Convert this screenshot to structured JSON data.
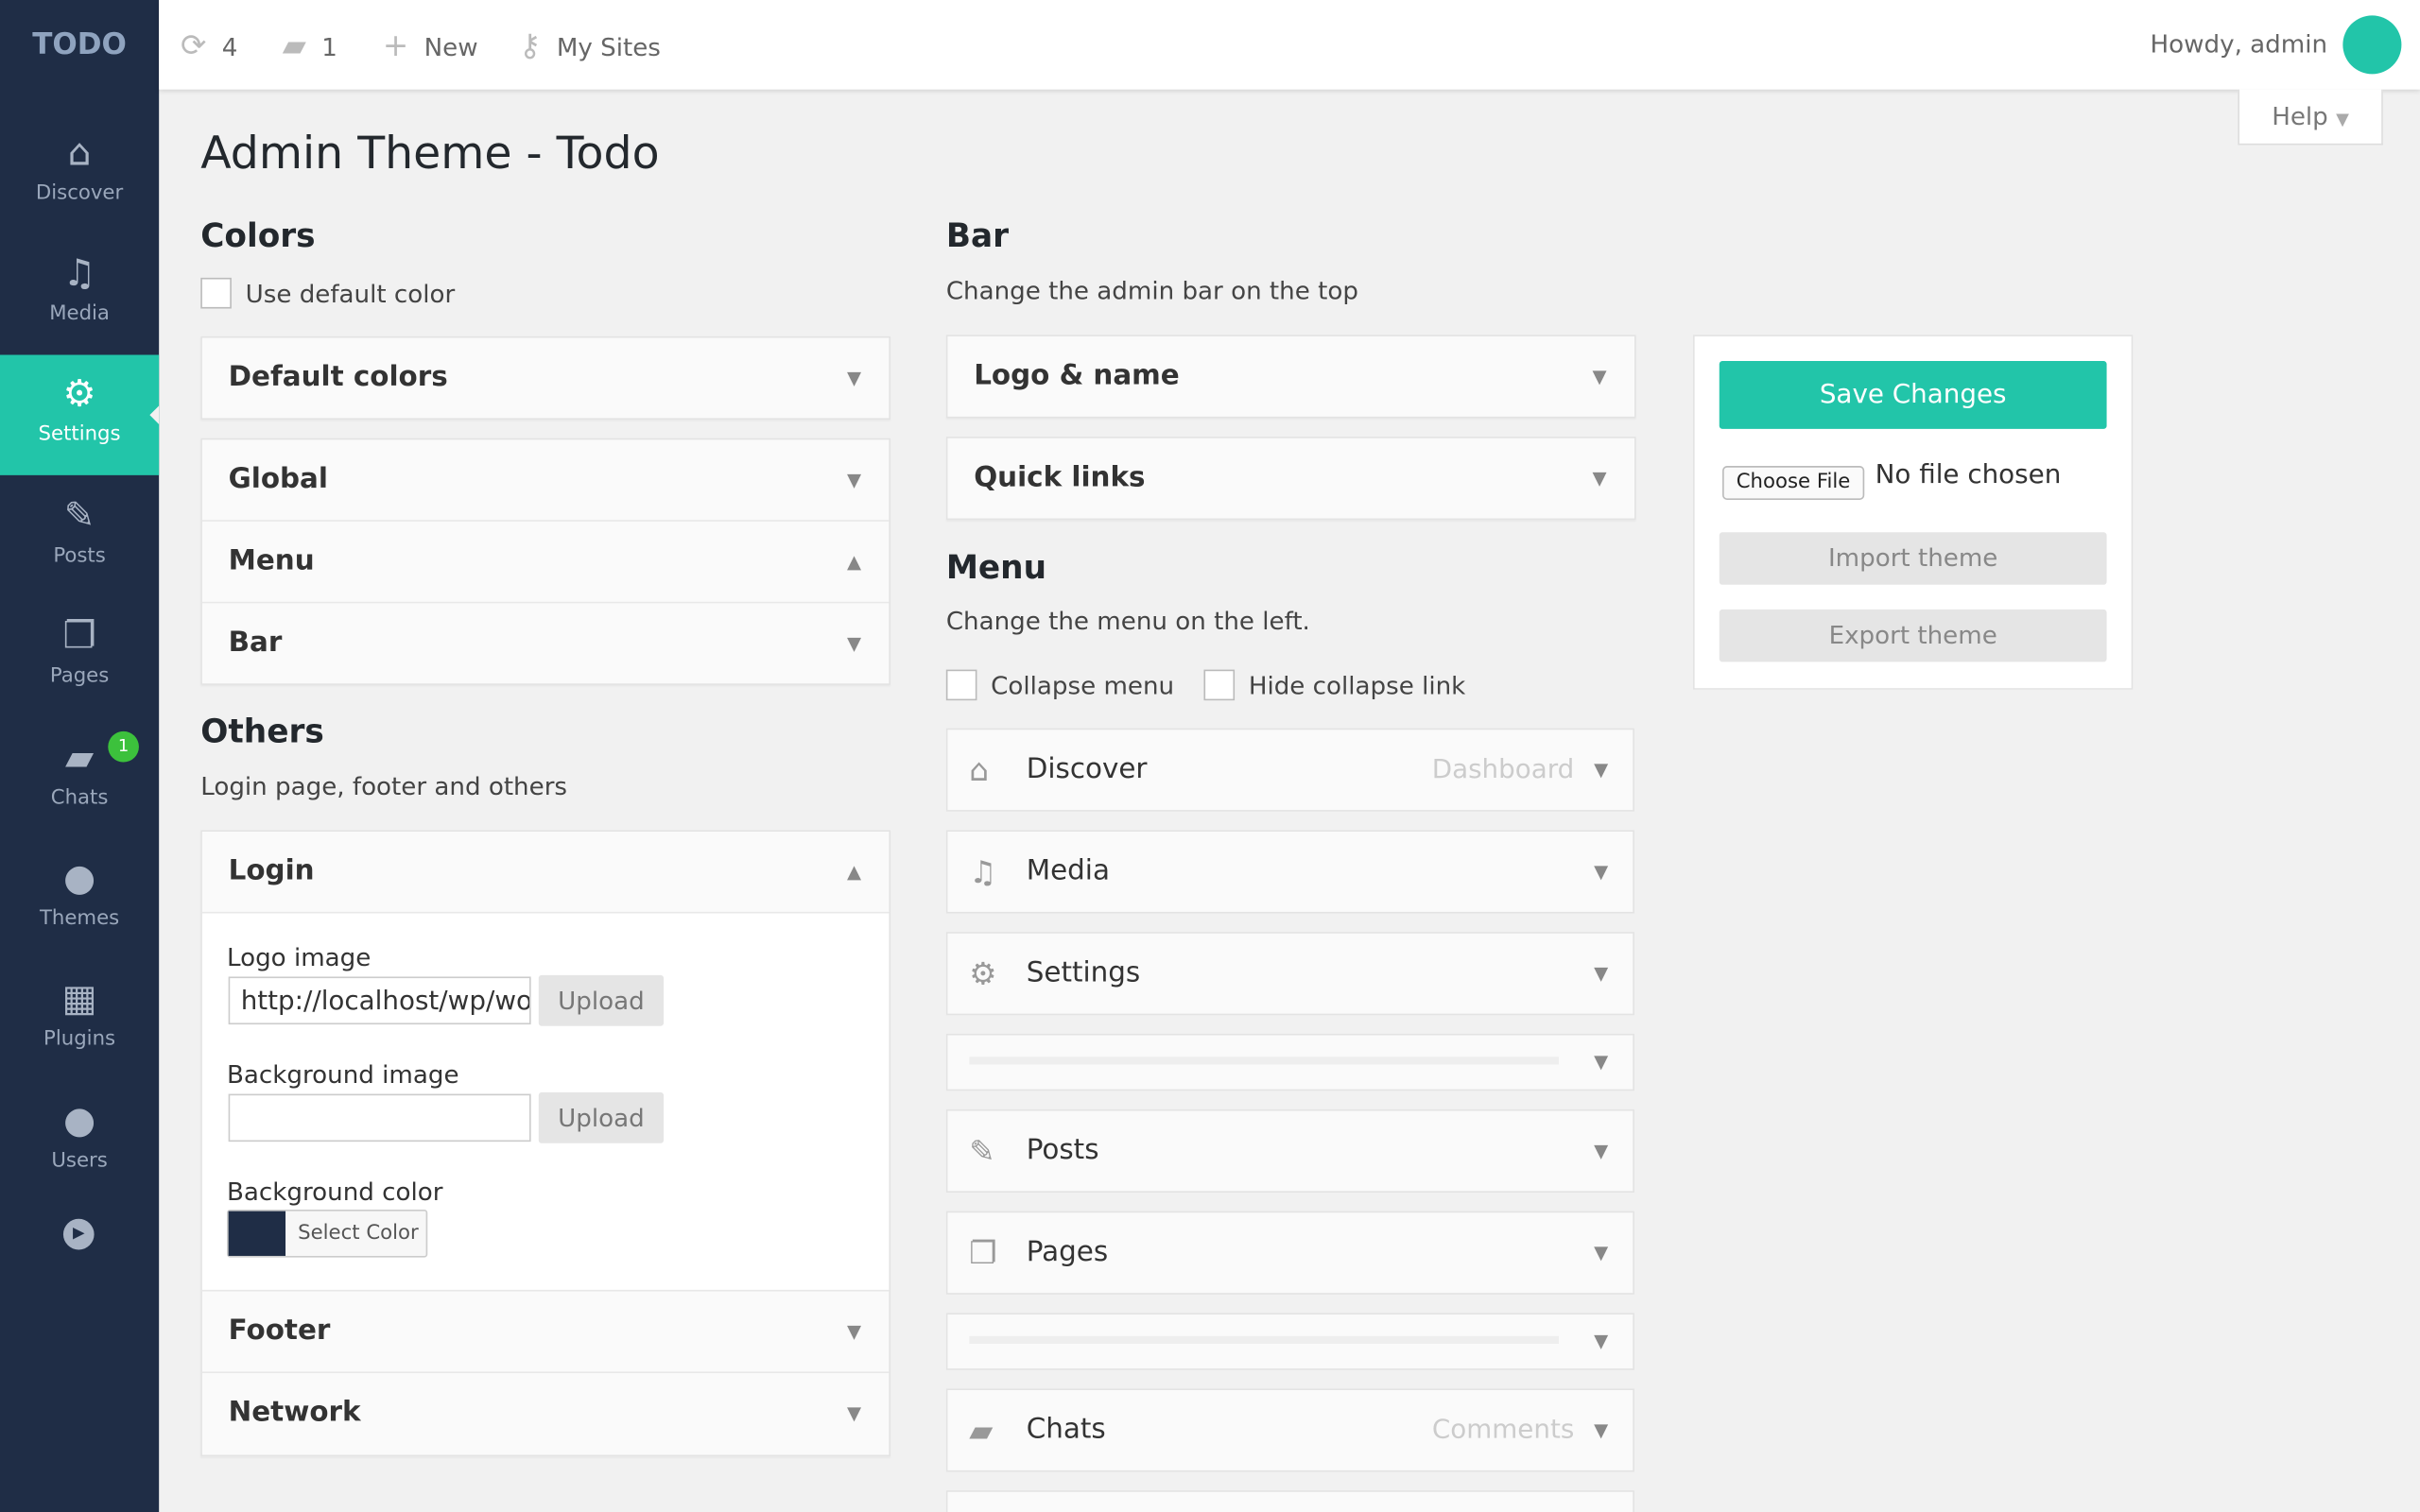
{
  "app": {
    "logo": "TODO",
    "title": "Admin Theme - Todo"
  },
  "topbar": {
    "updates": "4",
    "comments": "1",
    "new": "New",
    "my_sites": "My Sites",
    "howdy": "Howdy, admin",
    "help": "Help"
  },
  "sidebar": {
    "items": [
      {
        "label": "Discover",
        "icon": "home-icon"
      },
      {
        "label": "Media",
        "icon": "media-icon"
      },
      {
        "label": "Settings",
        "icon": "gear-icon",
        "active": true
      },
      {
        "label": "Posts",
        "icon": "pin-icon"
      },
      {
        "label": "Pages",
        "icon": "pages-icon"
      },
      {
        "label": "Chats",
        "icon": "chat-icon",
        "badge": "1"
      },
      {
        "label": "Themes",
        "icon": "drop-icon"
      },
      {
        "label": "Plugins",
        "icon": "grid-icon"
      },
      {
        "label": "Users",
        "icon": "user-icon"
      }
    ]
  },
  "colors": {
    "heading": "Colors",
    "use_default": "Use default color",
    "sections": [
      "Default colors",
      "Global",
      "Menu",
      "Bar"
    ]
  },
  "others": {
    "heading": "Others",
    "desc": "Login page, footer and others",
    "login": "Login",
    "logo_image_label": "Logo image",
    "logo_image_value": "http://localhost/wp/wo",
    "upload": "Upload",
    "bg_image_label": "Background image",
    "bg_image_value": "",
    "bg_color_label": "Background color",
    "select_color": "Select Color",
    "bg_color": "#1f2d46",
    "footer": "Footer",
    "network": "Network"
  },
  "bar": {
    "heading": "Bar",
    "desc": "Change the admin bar on the top",
    "sections": [
      "Logo & name",
      "Quick links"
    ]
  },
  "menu": {
    "heading": "Menu",
    "desc": "Change the menu on the left.",
    "collapse": "Collapse menu",
    "hide_collapse": "Hide collapse link",
    "items": [
      {
        "label": "Discover",
        "sub": "Dashboard"
      },
      {
        "label": "Media",
        "sub": ""
      },
      {
        "label": "Settings",
        "sub": ""
      },
      {
        "label": "Posts",
        "sub": ""
      },
      {
        "label": "Pages",
        "sub": ""
      },
      {
        "label": "Chats",
        "sub": "Comments"
      }
    ]
  },
  "actions": {
    "save": "Save Changes",
    "choose_file": "Choose File",
    "no_file": "No file chosen",
    "import": "Import theme",
    "export": "Export theme"
  },
  "accent": "#22c5a9"
}
